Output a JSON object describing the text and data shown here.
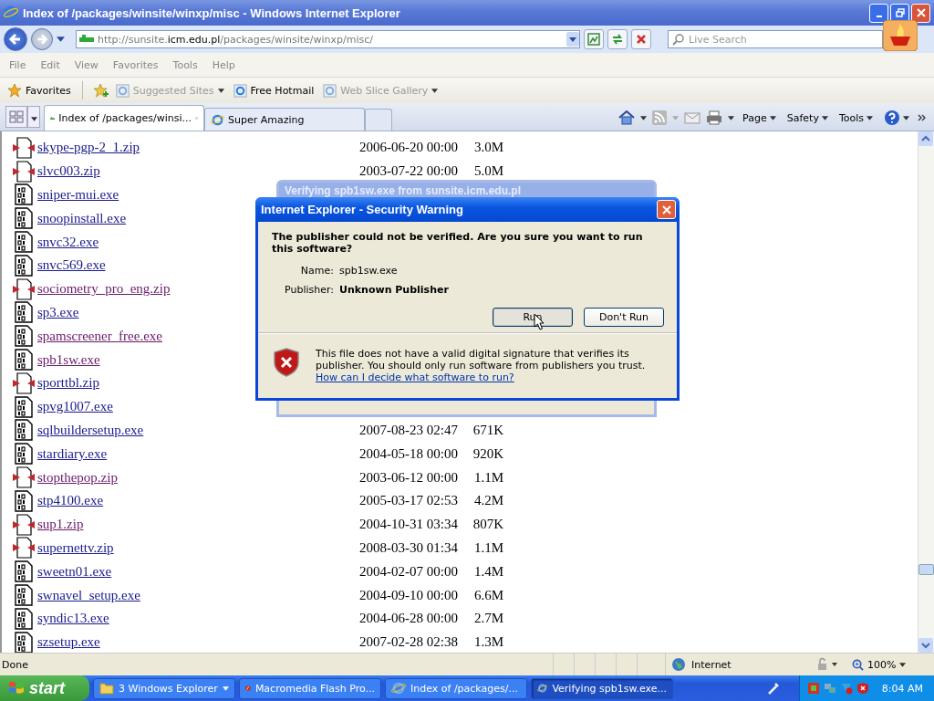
{
  "window": {
    "title": "Index of /packages/winsite/winxp/misc - Windows Internet Explorer"
  },
  "address_bar": {
    "url_parts": [
      {
        "text": "http://sunsite.",
        "highlight": false
      },
      {
        "text": "icm.edu.pl",
        "highlight": true
      },
      {
        "text": "/packages/winsite/winxp/misc/",
        "highlight": false
      }
    ],
    "search_placeholder": "Live Search"
  },
  "menu": [
    "File",
    "Edit",
    "View",
    "Favorites",
    "Tools",
    "Help"
  ],
  "favorites_bar": {
    "label": "Favorites",
    "items": [
      {
        "label": "Suggested Sites",
        "dimmed": true,
        "dropdown": true
      },
      {
        "label": "Free Hotmail",
        "dimmed": false,
        "dropdown": false
      },
      {
        "label": "Web Slice Gallery",
        "dimmed": true,
        "dropdown": true
      }
    ]
  },
  "tabs": [
    {
      "label": "Index of /packages/winsi...",
      "selected": true
    },
    {
      "label": "Super Amazing",
      "selected": false
    }
  ],
  "command_bar": [
    "Page",
    "Safety",
    "Tools"
  ],
  "files": [
    {
      "kind": "zip",
      "name": "skype-pgp-2_1.zip",
      "visited": false,
      "date": "2006-06-20 00:00",
      "size": "3.0M"
    },
    {
      "kind": "zip",
      "name": "slvc003.zip",
      "visited": false,
      "date": "2003-07-22 00:00",
      "size": "5.0M"
    },
    {
      "kind": "exe",
      "name": "sniper-mui.exe",
      "visited": false
    },
    {
      "kind": "exe",
      "name": "snoopinstall.exe",
      "visited": false
    },
    {
      "kind": "exe",
      "name": "snvc32.exe",
      "visited": false
    },
    {
      "kind": "exe",
      "name": "snvc569.exe",
      "visited": false
    },
    {
      "kind": "zip",
      "name": "sociometry_pro_eng.zip",
      "visited": true
    },
    {
      "kind": "exe",
      "name": "sp3.exe",
      "visited": false
    },
    {
      "kind": "exe",
      "name": "spamscreener_free.exe",
      "visited": true
    },
    {
      "kind": "exe",
      "name": "spb1sw.exe",
      "visited": true
    },
    {
      "kind": "zip",
      "name": "sporttbl.zip",
      "visited": false
    },
    {
      "kind": "exe",
      "name": "spvg1007.exe",
      "visited": false
    },
    {
      "kind": "exe",
      "name": "sqlbuildersetup.exe",
      "visited": false,
      "date": "2007-08-23 02:47",
      "size": "671K"
    },
    {
      "kind": "exe",
      "name": "stardiary.exe",
      "visited": false,
      "date": "2004-05-18 00:00",
      "size": "920K"
    },
    {
      "kind": "zip",
      "name": "stopthepop.zip",
      "visited": true,
      "date": "2003-06-12 00:00",
      "size": "1.1M"
    },
    {
      "kind": "exe",
      "name": "stp4100.exe",
      "visited": false,
      "date": "2005-03-17 02:53",
      "size": "4.2M"
    },
    {
      "kind": "zip",
      "name": "sup1.zip",
      "visited": true,
      "date": "2004-10-31 03:34",
      "size": "807K"
    },
    {
      "kind": "zip",
      "name": "supernettv.zip",
      "visited": false,
      "date": "2008-03-30 01:34",
      "size": "1.1M"
    },
    {
      "kind": "exe",
      "name": "sweetn01.exe",
      "visited": false,
      "date": "2004-02-07 00:00",
      "size": "1.4M"
    },
    {
      "kind": "exe",
      "name": "swnavel_setup.exe",
      "visited": false,
      "date": "2004-09-10 00:00",
      "size": "6.6M"
    },
    {
      "kind": "exe",
      "name": "syndic13.exe",
      "visited": false,
      "date": "2004-06-28 00:00",
      "size": "2.7M"
    },
    {
      "kind": "exe",
      "name": "szsetup.exe",
      "visited": false,
      "date": "2007-02-28 02:38",
      "size": "1.3M"
    }
  ],
  "background_window": {
    "title": "Verifying spb1sw.exe from sunsite.icm.edu.pl"
  },
  "dialog": {
    "title": "Internet Explorer - Security Warning",
    "question": "The publisher could not be verified.  Are you sure you want to run this software?",
    "fields": [
      {
        "label": "Name:",
        "value": "spb1sw.exe",
        "bold": false
      },
      {
        "label": "Publisher:",
        "value": "Unknown Publisher",
        "bold": true
      }
    ],
    "buttons": [
      {
        "label": "Run",
        "focused": true
      },
      {
        "label": "Don't Run",
        "focused": false
      }
    ],
    "warning": "This file does not have a valid digital signature that verifies its publisher. You should only run software from publishers you trust.",
    "help_link": "How can I decide what software to run?"
  },
  "status_bar": {
    "text": "Done",
    "zone": "Internet",
    "zoom": "100%"
  },
  "taskbar": {
    "start": "start",
    "items": [
      {
        "label": "3 Windows Explorer",
        "selected": false,
        "kind": "folder"
      },
      {
        "label": "Macromedia Flash Pro...",
        "selected": false,
        "kind": "flash"
      },
      {
        "label": "Index of /packages/...",
        "selected": false,
        "kind": "ie"
      },
      {
        "label": "Verifying spb1sw.exe...",
        "selected": true,
        "kind": "ie"
      }
    ],
    "clock": "8:04 AM"
  }
}
